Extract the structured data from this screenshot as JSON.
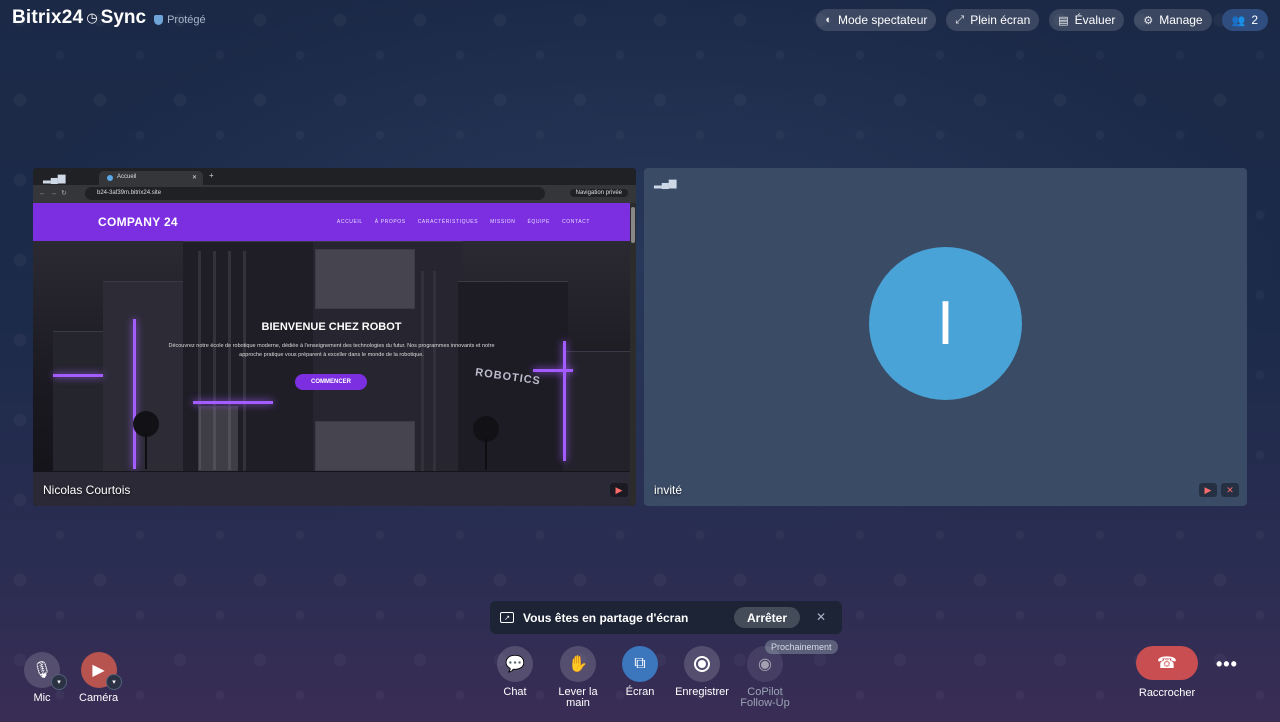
{
  "header": {
    "brand": "Bitrix24",
    "brand_suffix": "Sync",
    "protected_label": "Protégé",
    "buttons": {
      "spectator": "Mode spectateur",
      "fullscreen": "Plein écran",
      "rate": "Évaluer",
      "manage": "Manage",
      "participants_count": "2"
    }
  },
  "tiles": {
    "left": {
      "name": "Nicolas Courtois",
      "browser": {
        "tab_title": "Accueil",
        "url": "b24-3af39m.bitrix24.site",
        "private_label": "Navigation privée"
      },
      "site": {
        "logo": "COMPANY 24",
        "menu": [
          "ACCUEIL",
          "À PROPOS",
          "CARACTÉRISTIQUES",
          "MISSION",
          "ÉQUIPE",
          "CONTACT"
        ],
        "hero_title": "BIENVENUE CHEZ ROBOT",
        "hero_text": "Découvrez notre école de robotique moderne, dédiée à l'enseignement des technologies du futur. Nos programmes innovants et notre approche pratique vous préparent à exceller dans le monde de la robotique.",
        "hero_button": "COMMENCER",
        "building_sign": "ROBOTICS"
      }
    },
    "right": {
      "name": "invité",
      "avatar_letter": "I",
      "avatar_color": "#4aa3d6"
    }
  },
  "share_banner": {
    "text": "Vous êtes en partage d'écran",
    "stop_label": "Arrêter"
  },
  "upcoming_badge": "Prochainement",
  "controls": {
    "mic": "Mic",
    "camera": "Caméra",
    "chat": "Chat",
    "raise_hand_line1": "Lever la",
    "raise_hand_line2": "main",
    "screen": "Écran",
    "record": "Enregistrer",
    "copilot_line1": "CoPilot",
    "copilot_line2": "Follow-Up",
    "hangup": "Raccrocher"
  },
  "colors": {
    "accent": "#3c76bd",
    "hangup": "#c94e52",
    "site_brand": "#7b2fe0"
  }
}
